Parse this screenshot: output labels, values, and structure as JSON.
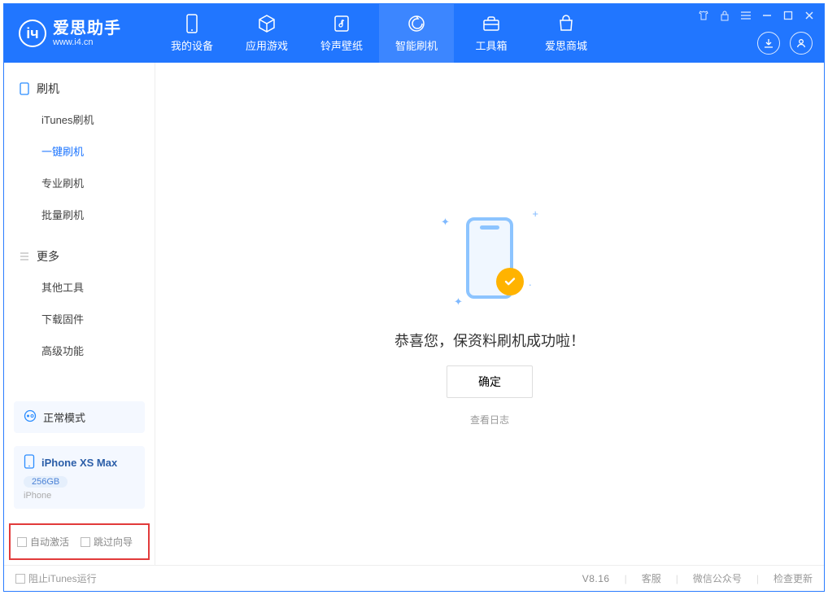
{
  "app": {
    "title": "爱思助手",
    "subtitle": "www.i4.cn"
  },
  "nav": {
    "items": [
      {
        "label": "我的设备"
      },
      {
        "label": "应用游戏"
      },
      {
        "label": "铃声壁纸"
      },
      {
        "label": "智能刷机"
      },
      {
        "label": "工具箱"
      },
      {
        "label": "爱思商城"
      }
    ]
  },
  "sidebar": {
    "section1": {
      "title": "刷机",
      "items": [
        {
          "label": "iTunes刷机"
        },
        {
          "label": "一键刷机"
        },
        {
          "label": "专业刷机"
        },
        {
          "label": "批量刷机"
        }
      ]
    },
    "section2": {
      "title": "更多",
      "items": [
        {
          "label": "其他工具"
        },
        {
          "label": "下载固件"
        },
        {
          "label": "高级功能"
        }
      ]
    },
    "mode": "正常模式",
    "device": {
      "name": "iPhone XS Max",
      "storage": "256GB",
      "type": "iPhone"
    },
    "options": {
      "opt1": "自动激活",
      "opt2": "跳过向导"
    }
  },
  "main": {
    "message": "恭喜您，保资料刷机成功啦！",
    "ok": "确定",
    "log": "查看日志"
  },
  "footer": {
    "block_itunes": "阻止iTunes运行",
    "version": "V8.16",
    "support": "客服",
    "wechat": "微信公众号",
    "update": "检查更新"
  }
}
